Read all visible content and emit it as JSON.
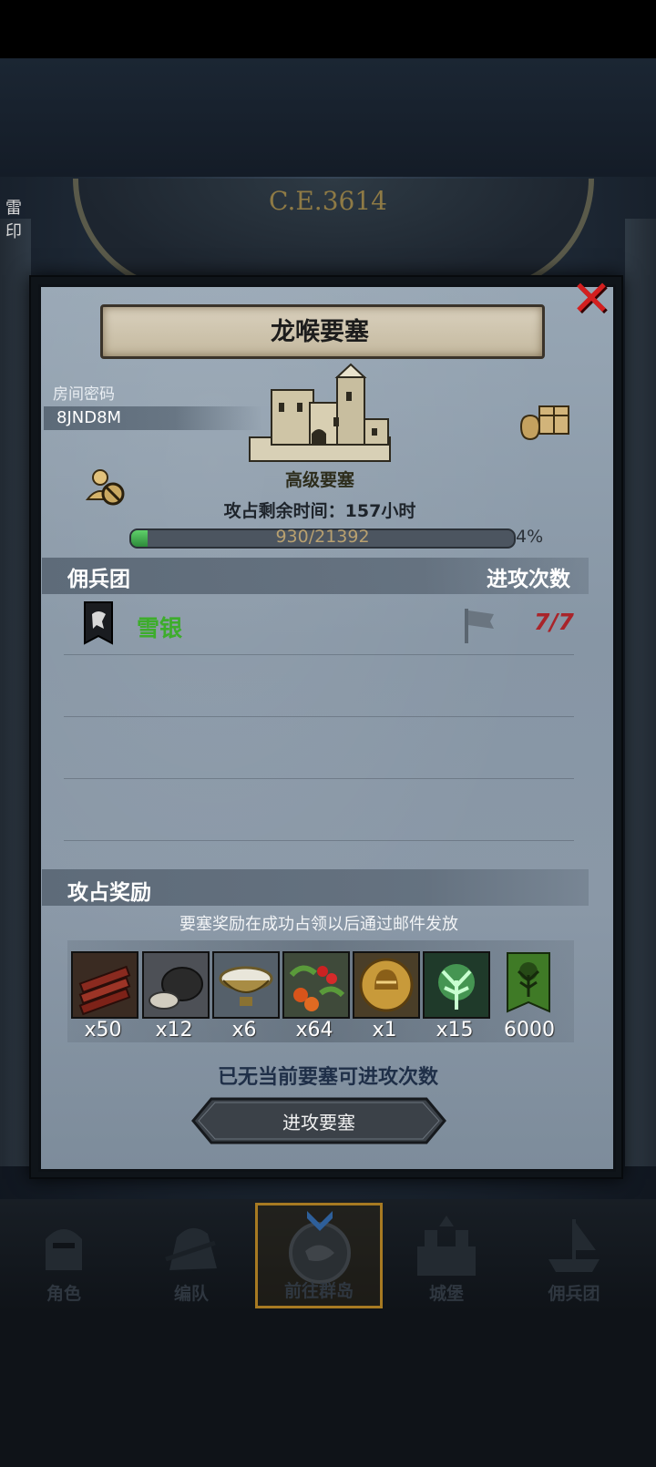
{
  "background": {
    "era_label": "C.E.3614",
    "side_text": "雷印"
  },
  "dialog": {
    "title": "龙喉要塞",
    "close_icon": "close-x-icon",
    "room": {
      "label": "房间密码",
      "code": "8JND8M"
    },
    "fortress": {
      "type": "高级要塞",
      "time_text": "攻占剩余时间：157小时",
      "progress_text": "930/21392",
      "progress_value": 930,
      "progress_max": 21392,
      "progress_percent": "4%"
    },
    "mercenary": {
      "header": "佣兵团",
      "attack_header": "进攻次数",
      "guild_name": "雪银",
      "attack_count": "7/7"
    },
    "reward": {
      "header": "攻占奖励",
      "note": "要塞奖励在成功占领以后通过邮件发放",
      "items": [
        {
          "icon": "wood-planks-icon",
          "qty": "x50"
        },
        {
          "icon": "ore-rock-icon",
          "qty": "x12"
        },
        {
          "icon": "salt-bowl-icon",
          "qty": "x6"
        },
        {
          "icon": "berries-icon",
          "qty": "x64"
        },
        {
          "icon": "gold-helmet-coin-icon",
          "qty": "x1"
        },
        {
          "icon": "green-tree-spirit-icon",
          "qty": "x15"
        },
        {
          "icon": "guild-tree-banner-icon",
          "qty": "6000"
        }
      ]
    },
    "no_attack_text": "已无当前要塞可进攻次数",
    "attack_button": "进攻要塞"
  },
  "nav": {
    "items": [
      {
        "label": "角色",
        "icon": "character-helmet-icon"
      },
      {
        "label": "编队",
        "icon": "formation-knight-icon"
      },
      {
        "label": "前往群岛",
        "icon": "archipelago-compass-icon",
        "active": true
      },
      {
        "label": "城堡",
        "icon": "castle-icon"
      },
      {
        "label": "佣兵团",
        "icon": "mercenary-ship-icon"
      }
    ]
  },
  "colors": {
    "close": "#d41f1f",
    "guild_name": "#3dad2b",
    "attack_count": "#a9242a",
    "progress_fill": "#3fa84a",
    "active_nav_border": "#a77a22"
  }
}
